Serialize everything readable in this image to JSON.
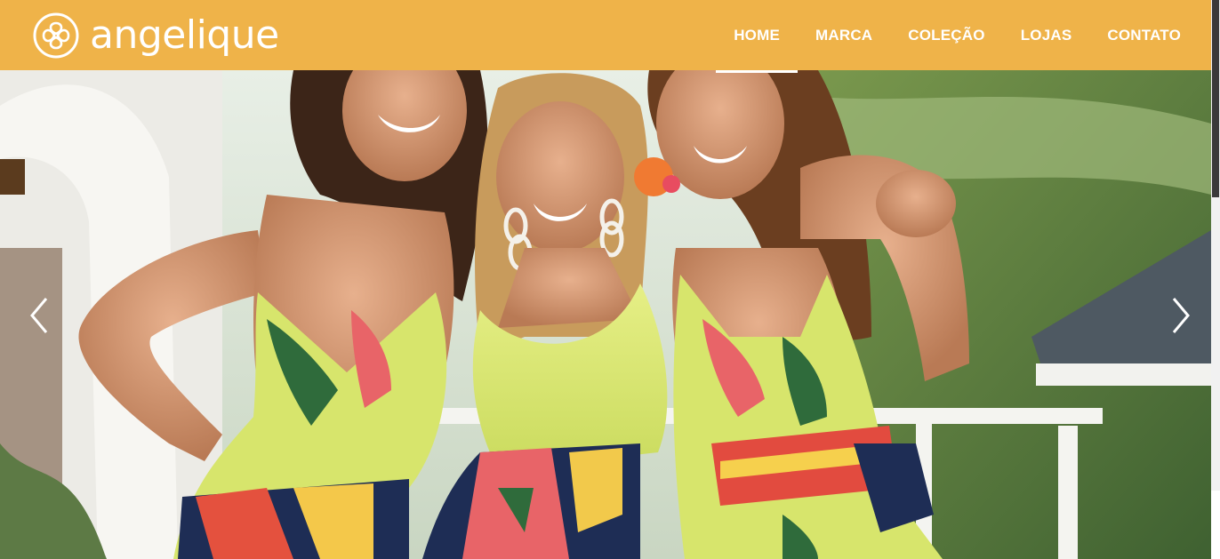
{
  "brand": {
    "name": "angelique",
    "colors": {
      "header": "#efb349",
      "text": "#ffffff"
    }
  },
  "nav": {
    "items": [
      {
        "label": "HOME",
        "active": true
      },
      {
        "label": "MARCA",
        "active": false
      },
      {
        "label": "COLEÇÃO",
        "active": false
      },
      {
        "label": "LOJAS",
        "active": false
      },
      {
        "label": "CONTATO",
        "active": false
      }
    ]
  },
  "hero": {
    "image": "three-smiling-women-in-tropical-print-outfits",
    "prev_icon": "chevron-left-icon",
    "next_icon": "chevron-right-icon"
  }
}
